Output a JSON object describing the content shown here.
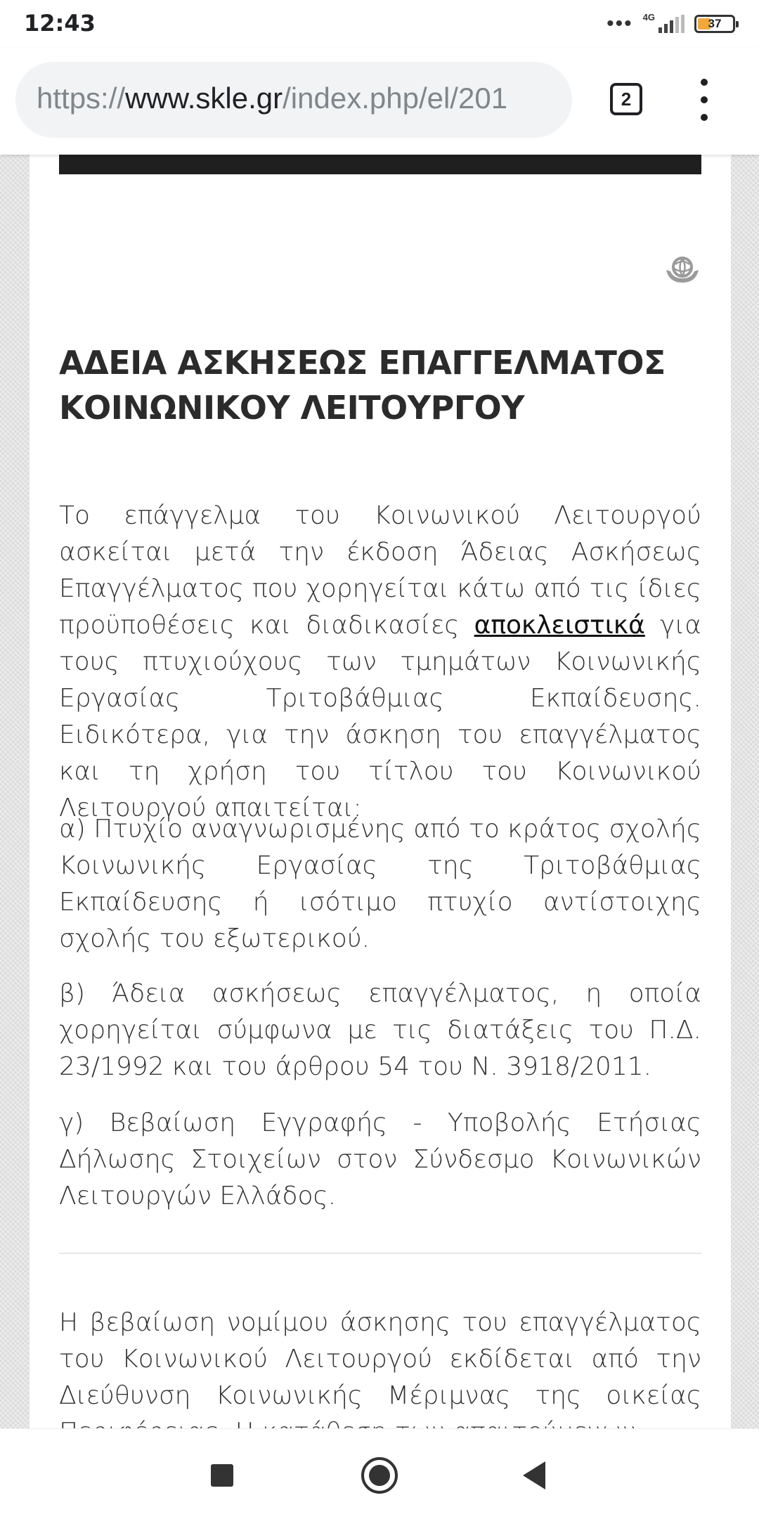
{
  "status_bar": {
    "time": "12:43",
    "dots": "•••",
    "network": "4G",
    "battery": "37",
    "battery_color": "#f2a73b"
  },
  "browser": {
    "url_scheme": "https://",
    "url_host": "www.skle.gr",
    "url_path": "/index.php/el/201",
    "tab_count": "2",
    "menu_icon": "more-vert-icon"
  },
  "article": {
    "title": "ΑΔΕΙΑ ΑΣΚΗΣΕΩΣ ΕΠΑΓΓΕΛΜΑΤΟΣ ΚΟΙΝΩΝΙΚΟΥ ΛΕΙΤΟΥΡΓΟΥ",
    "intro_before": "Το επάγγελμα του Κοινωνικού Λειτουργού ασκείται μετά την έκδοση Άδειας Ασκήσεως Επαγγέλματος που χορηγείται κάτω από τις ίδιες προϋποθέσεις και διαδικασίες ",
    "intro_link": "αποκλειστικά",
    "intro_after": " για τους πτυχιούχους των τμημάτων Κοινωνικής Εργασίας Τριτοβάθμιας Εκπαίδευσης. Ειδικότερα, για την άσκηση του επαγγέλματος και τη χρήση του τίτλου του Κοινωνικού Λειτουργού απαιτείται:",
    "item_a": "α) Πτυχίο αναγνωρισμένης από το κράτος σχολής Κοινωνικής Εργασίας της Τριτοβάθμιας Εκπαίδευσης ή ισότιμο πτυχίο αντίστοιχης σχολής του εξωτερικού.",
    "item_b": "β) Άδεια ασκήσεως επαγγέλματος, η οποία χορηγείται σύμφωνα με τις διατάξεις του Π.Δ. 23/1992 και του άρθρου 54 του Ν. 3918/2011.",
    "item_c": "γ) Βεβαίωση Εγγραφής - Υποβολής Ετήσιας Δήλωσης Στοιχείων στον Σύνδεσμο Κοινωνικών Λειτουργών Ελλάδος.",
    "certification": "Η βεβαίωση νομίμου άσκησης του επαγγέλματος του Κοινωνικού Λειτουργού εκδίδεται από την Διεύθυνση Κοινωνικής Μέριμνας της οικείας Περιφέρειας. Η κατάθεση των απαιτούμενων",
    "badge_icon": "globe-hands-icon"
  },
  "nav_bar": {
    "recents_icon": "square-icon",
    "home_icon": "home-circle-icon",
    "back_icon": "back-triangle-icon"
  }
}
